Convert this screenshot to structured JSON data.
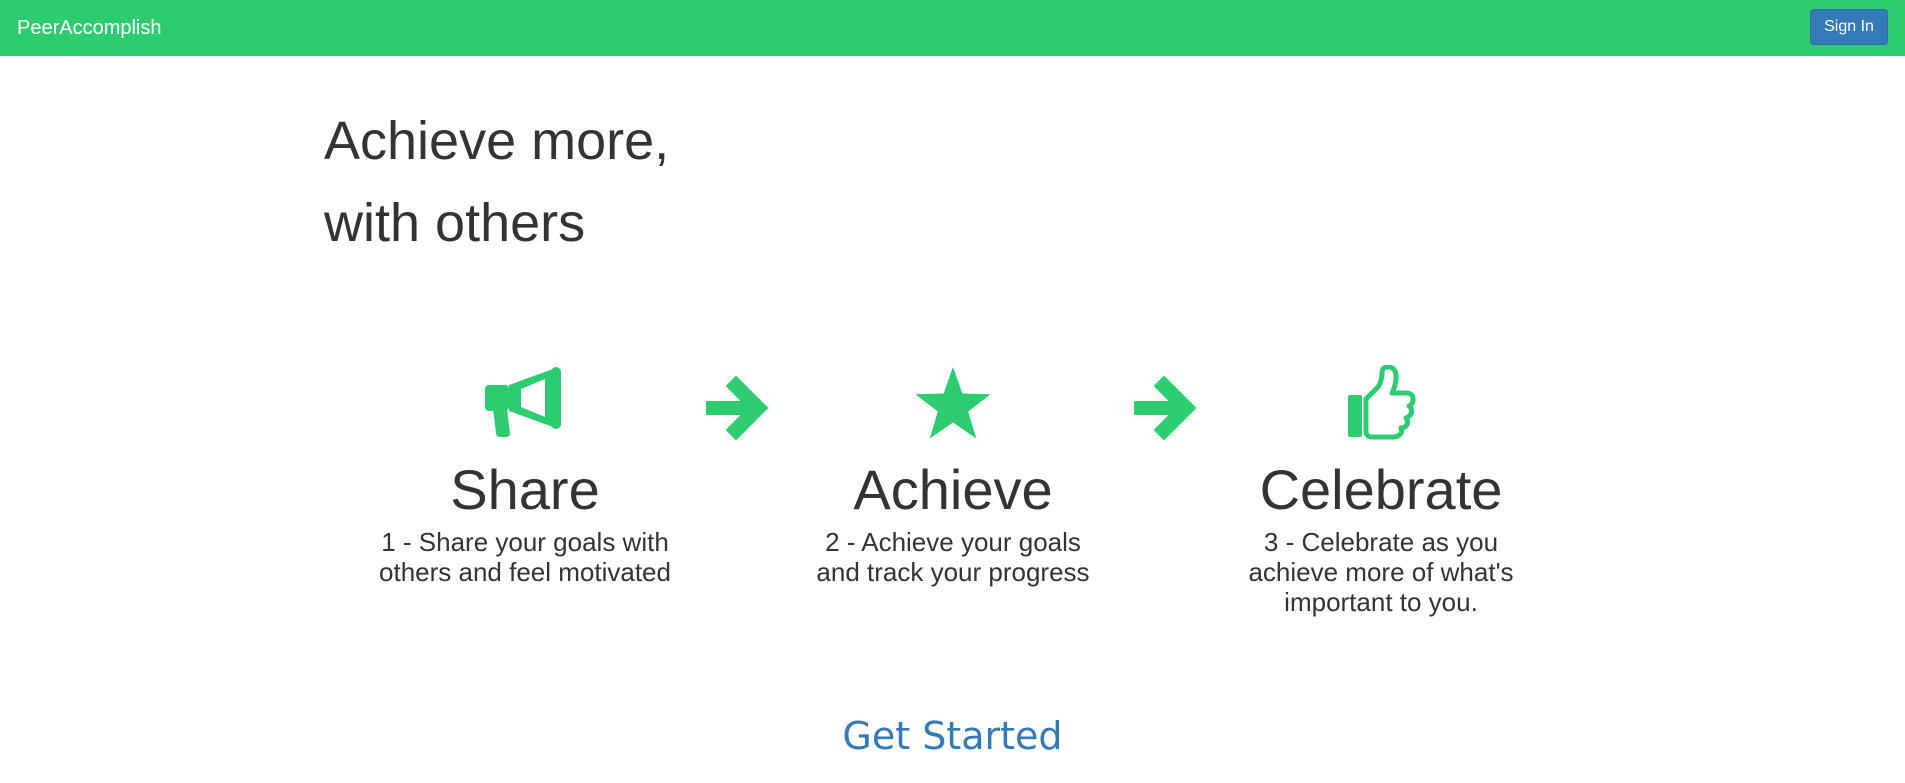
{
  "nav": {
    "brand": "PeerAccomplish",
    "sign_in_label": "Sign In"
  },
  "hero": {
    "line1": "Achieve more,",
    "line2": "with others"
  },
  "steps": [
    {
      "icon": "bullhorn-icon",
      "title": "Share",
      "description": "1 - Share your goals with others and feel motivated"
    },
    {
      "icon": "star-icon",
      "title": "Achieve",
      "description": "2 - Achieve your goals and track your progress"
    },
    {
      "icon": "thumbs-up-icon",
      "title": "Celebrate",
      "description": "3 - Celebrate as you achieve more of what's important to you."
    }
  ],
  "cta": {
    "label": "Get Started"
  },
  "colors": {
    "brand_green": "#2ecc71",
    "primary_blue": "#337ab7",
    "text": "#333333"
  }
}
